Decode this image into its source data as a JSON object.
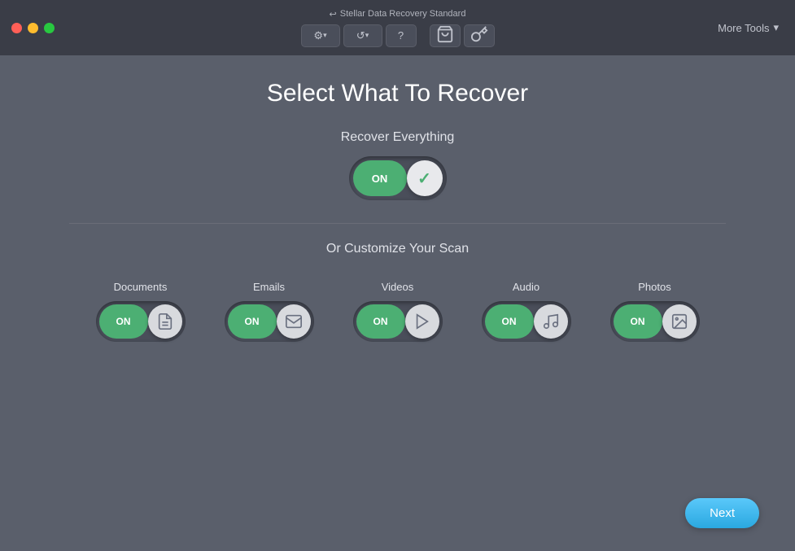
{
  "titleBar": {
    "appTitle": "Stellar Data Recovery Standard",
    "moreTools": "More Tools"
  },
  "toolbar": {
    "settingsLabel": "⚙",
    "historyLabel": "↺",
    "helpLabel": "?",
    "cartLabel": "🛒",
    "keyLabel": "🔑"
  },
  "main": {
    "pageTitle": "Select What To Recover",
    "recoverEverythingLabel": "Recover Everything",
    "toggleOnLabel": "ON",
    "customizeScanLabel": "Or Customize Your Scan",
    "categories": [
      {
        "id": "documents",
        "label": "Documents",
        "icon": "document"
      },
      {
        "id": "emails",
        "label": "Emails",
        "icon": "email"
      },
      {
        "id": "videos",
        "label": "Videos",
        "icon": "video"
      },
      {
        "id": "audio",
        "label": "Audio",
        "icon": "audio"
      },
      {
        "id": "photos",
        "label": "Photos",
        "icon": "photo"
      }
    ],
    "nextButton": "Next"
  }
}
